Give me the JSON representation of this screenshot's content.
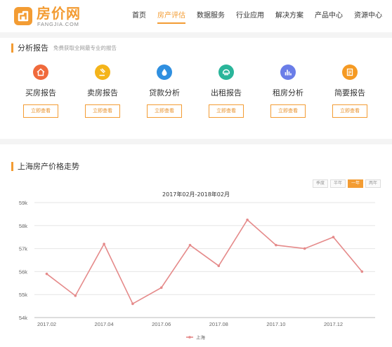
{
  "brand": {
    "name": "房价网",
    "domain": "FANGJIA.COM",
    "color": "#f39c33"
  },
  "nav": {
    "items": [
      {
        "label": "首页",
        "active": false
      },
      {
        "label": "房产评估",
        "active": true
      },
      {
        "label": "数据服务",
        "active": false
      },
      {
        "label": "行业应用",
        "active": false
      },
      {
        "label": "解决方案",
        "active": false
      },
      {
        "label": "产品中心",
        "active": false
      },
      {
        "label": "资源中心",
        "active": false
      }
    ]
  },
  "analysis": {
    "title": "分析报告",
    "subtitle": "免费获取全网最专业的报告",
    "cards": [
      {
        "label": "买房报告",
        "button": "立即查看",
        "icon": "home-icon",
        "color": "#f06a3c"
      },
      {
        "label": "卖房报告",
        "button": "立即查看",
        "icon": "gavel-icon",
        "color": "#f4b41a"
      },
      {
        "label": "贷款分析",
        "button": "立即查看",
        "icon": "drop-icon",
        "color": "#2f8fe0"
      },
      {
        "label": "出租报告",
        "button": "立即查看",
        "icon": "building-icon",
        "color": "#2ab59a"
      },
      {
        "label": "租房分析",
        "button": "立即查看",
        "icon": "bar-chart-icon",
        "color": "#6a7de8"
      },
      {
        "label": "简要报告",
        "button": "立即查看",
        "icon": "document-icon",
        "color": "#f59a23"
      }
    ]
  },
  "trend": {
    "title": "上海房产价格走势",
    "range_tabs": [
      {
        "label": "季度",
        "active": false
      },
      {
        "label": "半年",
        "active": false
      },
      {
        "label": "一年",
        "active": true
      },
      {
        "label": "两年",
        "active": false
      }
    ]
  },
  "chart_data": {
    "type": "line",
    "title": "2017年02月-2018年02月",
    "x": [
      "2017.02",
      "2017.03",
      "2017.04",
      "2017.05",
      "2017.06",
      "2017.07",
      "2017.08",
      "2017.09",
      "2017.10",
      "2017.11",
      "2017.12",
      "2018.01"
    ],
    "x_tick_labels": [
      "2017.02",
      "2017.04",
      "2017.06",
      "2017.08",
      "2017.10",
      "2017.12"
    ],
    "series": [
      {
        "name": "上海",
        "values": [
          55900,
          54950,
          57200,
          54600,
          55300,
          57150,
          56250,
          58250,
          57150,
          57000,
          57500,
          56000
        ],
        "color": "#e58a8a"
      }
    ],
    "y_ticks": [
      "54k",
      "55k",
      "56k",
      "57k",
      "58k",
      "59k"
    ],
    "ylim": [
      54000,
      59000
    ],
    "grid": true,
    "legend": "bottom"
  }
}
